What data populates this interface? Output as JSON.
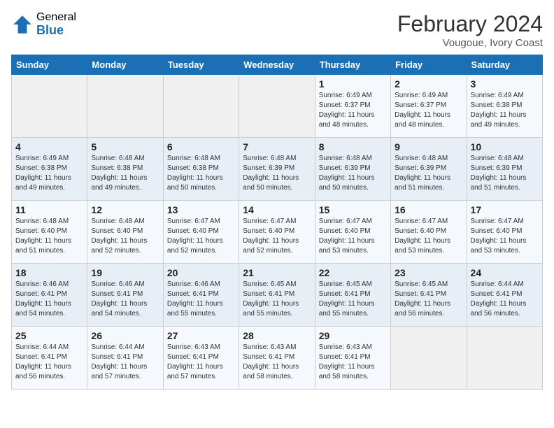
{
  "header": {
    "logo_general": "General",
    "logo_blue": "Blue",
    "title": "February 2024",
    "location": "Vougoue, Ivory Coast"
  },
  "weekdays": [
    "Sunday",
    "Monday",
    "Tuesday",
    "Wednesday",
    "Thursday",
    "Friday",
    "Saturday"
  ],
  "weeks": [
    [
      {
        "day": "",
        "info": ""
      },
      {
        "day": "",
        "info": ""
      },
      {
        "day": "",
        "info": ""
      },
      {
        "day": "",
        "info": ""
      },
      {
        "day": "1",
        "info": "Sunrise: 6:49 AM\nSunset: 6:37 PM\nDaylight: 11 hours and 48 minutes."
      },
      {
        "day": "2",
        "info": "Sunrise: 6:49 AM\nSunset: 6:37 PM\nDaylight: 11 hours and 48 minutes."
      },
      {
        "day": "3",
        "info": "Sunrise: 6:49 AM\nSunset: 6:38 PM\nDaylight: 11 hours and 49 minutes."
      }
    ],
    [
      {
        "day": "4",
        "info": "Sunrise: 6:49 AM\nSunset: 6:38 PM\nDaylight: 11 hours and 49 minutes."
      },
      {
        "day": "5",
        "info": "Sunrise: 6:48 AM\nSunset: 6:38 PM\nDaylight: 11 hours and 49 minutes."
      },
      {
        "day": "6",
        "info": "Sunrise: 6:48 AM\nSunset: 6:38 PM\nDaylight: 11 hours and 50 minutes."
      },
      {
        "day": "7",
        "info": "Sunrise: 6:48 AM\nSunset: 6:39 PM\nDaylight: 11 hours and 50 minutes."
      },
      {
        "day": "8",
        "info": "Sunrise: 6:48 AM\nSunset: 6:39 PM\nDaylight: 11 hours and 50 minutes."
      },
      {
        "day": "9",
        "info": "Sunrise: 6:48 AM\nSunset: 6:39 PM\nDaylight: 11 hours and 51 minutes."
      },
      {
        "day": "10",
        "info": "Sunrise: 6:48 AM\nSunset: 6:39 PM\nDaylight: 11 hours and 51 minutes."
      }
    ],
    [
      {
        "day": "11",
        "info": "Sunrise: 6:48 AM\nSunset: 6:40 PM\nDaylight: 11 hours and 51 minutes."
      },
      {
        "day": "12",
        "info": "Sunrise: 6:48 AM\nSunset: 6:40 PM\nDaylight: 11 hours and 52 minutes."
      },
      {
        "day": "13",
        "info": "Sunrise: 6:47 AM\nSunset: 6:40 PM\nDaylight: 11 hours and 52 minutes."
      },
      {
        "day": "14",
        "info": "Sunrise: 6:47 AM\nSunset: 6:40 PM\nDaylight: 11 hours and 52 minutes."
      },
      {
        "day": "15",
        "info": "Sunrise: 6:47 AM\nSunset: 6:40 PM\nDaylight: 11 hours and 53 minutes."
      },
      {
        "day": "16",
        "info": "Sunrise: 6:47 AM\nSunset: 6:40 PM\nDaylight: 11 hours and 53 minutes."
      },
      {
        "day": "17",
        "info": "Sunrise: 6:47 AM\nSunset: 6:40 PM\nDaylight: 11 hours and 53 minutes."
      }
    ],
    [
      {
        "day": "18",
        "info": "Sunrise: 6:46 AM\nSunset: 6:41 PM\nDaylight: 11 hours and 54 minutes."
      },
      {
        "day": "19",
        "info": "Sunrise: 6:46 AM\nSunset: 6:41 PM\nDaylight: 11 hours and 54 minutes."
      },
      {
        "day": "20",
        "info": "Sunrise: 6:46 AM\nSunset: 6:41 PM\nDaylight: 11 hours and 55 minutes."
      },
      {
        "day": "21",
        "info": "Sunrise: 6:45 AM\nSunset: 6:41 PM\nDaylight: 11 hours and 55 minutes."
      },
      {
        "day": "22",
        "info": "Sunrise: 6:45 AM\nSunset: 6:41 PM\nDaylight: 11 hours and 55 minutes."
      },
      {
        "day": "23",
        "info": "Sunrise: 6:45 AM\nSunset: 6:41 PM\nDaylight: 11 hours and 56 minutes."
      },
      {
        "day": "24",
        "info": "Sunrise: 6:44 AM\nSunset: 6:41 PM\nDaylight: 11 hours and 56 minutes."
      }
    ],
    [
      {
        "day": "25",
        "info": "Sunrise: 6:44 AM\nSunset: 6:41 PM\nDaylight: 11 hours and 56 minutes."
      },
      {
        "day": "26",
        "info": "Sunrise: 6:44 AM\nSunset: 6:41 PM\nDaylight: 11 hours and 57 minutes."
      },
      {
        "day": "27",
        "info": "Sunrise: 6:43 AM\nSunset: 6:41 PM\nDaylight: 11 hours and 57 minutes."
      },
      {
        "day": "28",
        "info": "Sunrise: 6:43 AM\nSunset: 6:41 PM\nDaylight: 11 hours and 58 minutes."
      },
      {
        "day": "29",
        "info": "Sunrise: 6:43 AM\nSunset: 6:41 PM\nDaylight: 11 hours and 58 minutes."
      },
      {
        "day": "",
        "info": ""
      },
      {
        "day": "",
        "info": ""
      }
    ]
  ]
}
